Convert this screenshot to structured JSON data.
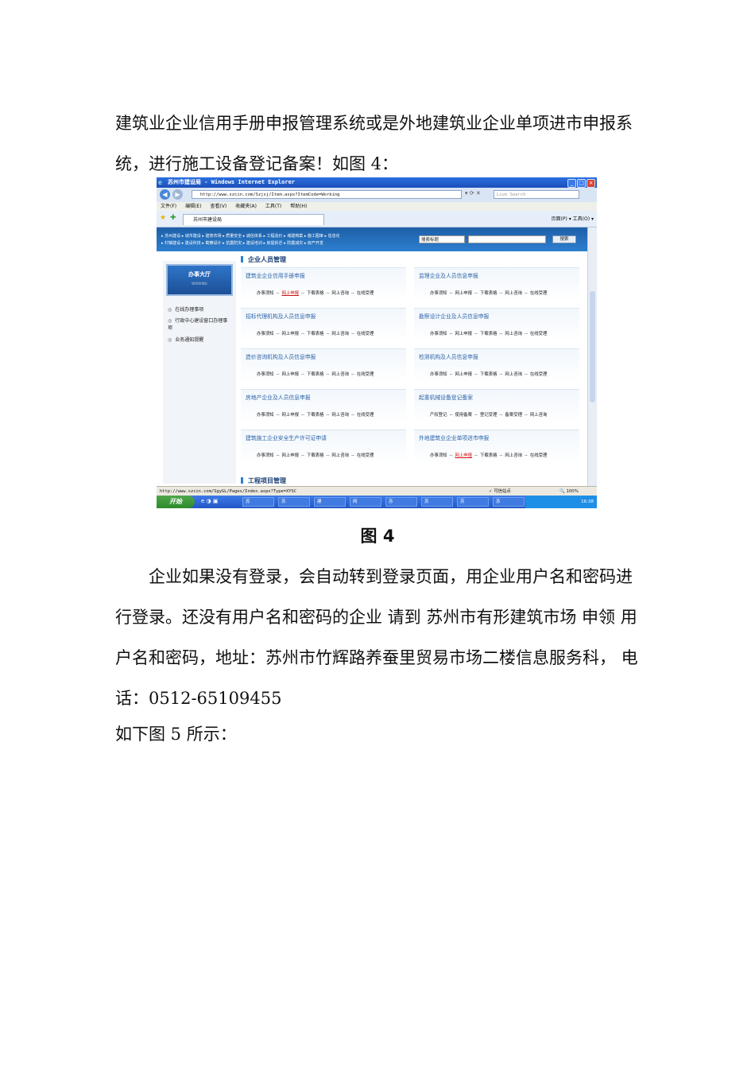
{
  "doc": {
    "para1": "建筑业企业信用手册申报管理系统或是外地建筑业企业单项进市申报系统，进行施工设备登记备案！如图 4：",
    "caption": "图 4",
    "para2": "企业如果没有登录，会自动转到登录页面，用企业用户名和密码进行登录。还没有用户名和密码的企业  请到  苏州市有形建筑市场  申领  用户名和密码，地址：苏州市竹辉路养蚕里贸易市场二楼信息服务科，   电话：0512-65109455",
    "para3": "如下图 5 所示："
  },
  "browser": {
    "window_title": "苏州市建设局 - Windows Internet Explorer",
    "address": "http://www.szcin.com/Szjsj/Item.aspx?ItemCode=Working",
    "live_search": "Live Search",
    "menu": [
      "文件(F)",
      "编辑(E)",
      "查看(V)",
      "收藏夹(A)",
      "工具(T)",
      "帮助(H)"
    ],
    "tab_title": "苏州市建设局",
    "cmd_tools": "页面(P) ▾  工具(O) ▾",
    "status_url": "http://www.szcin.com/SgyGL/Pages/Index.aspx?Type=XYSC",
    "status_zone": "可信站点",
    "zoom": "100%"
  },
  "site": {
    "header_links_1": "▸ 苏州建设 ▸ 城市建设 ▸ 建筑市场 ▸ 质量安全 ▸ 诚信体系 ▸ 工程造价 ▸ 城建档案 ▸ 施工图审 ▸ 信息化",
    "header_links_2": "▸ 村镇建设 ▸ 建设科技 ▸ 勘察设计 ▸ 抗震防灾 ▸ 建设培训 ▸ 房屋拆迁 ▸ 防震减灾 ▸ 房产开发",
    "search_select": "搜索标题",
    "search_button": "搜索",
    "hall_title": "办事大厅",
    "hall_sub": "WORKING",
    "sidebar": [
      "在线办理事项",
      "行政中心建设窗口办理事项",
      "业务通知提醒"
    ],
    "section1": "企业人员管理",
    "section2": "工程项目管理",
    "cards": [
      {
        "title": "建筑业企业信用手册申报",
        "links": [
          "办事须知",
          "网上申报",
          "下载表格",
          "网上咨询",
          "在线受理"
        ],
        "red": 1
      },
      {
        "title": "监理企业及人员信息申报",
        "links": [
          "办事须知",
          "网上申报",
          "下载表格",
          "网上咨询",
          "在线受理"
        ],
        "red": -1
      },
      {
        "title": "招标代理机构及人员信息申报",
        "links": [
          "办事须知",
          "网上申报",
          "下载表格",
          "网上咨询",
          "在线受理"
        ],
        "red": -1
      },
      {
        "title": "勘察设计企业及人员信息申报",
        "links": [
          "办事须知",
          "网上申报",
          "下载表格",
          "网上咨询",
          "在线受理"
        ],
        "red": -1
      },
      {
        "title": "造价咨询机构及人员信息申报",
        "links": [
          "办事须知",
          "网上申报",
          "下载表格",
          "网上咨询",
          "在线受理"
        ],
        "red": -1
      },
      {
        "title": "检测机构及人员信息申报",
        "links": [
          "办事须知",
          "网上申报",
          "下载表格",
          "网上咨询",
          "在线受理"
        ],
        "red": -1
      },
      {
        "title": "房地产企业及人员信息申报",
        "links": [
          "办事须知",
          "网上申报",
          "下载表格",
          "网上咨询",
          "在线受理"
        ],
        "red": -1
      },
      {
        "title": "起重机械设备登记备案",
        "links": [
          "产权登记",
          "使用备案",
          "登记受理",
          "备案受理",
          "网上咨询"
        ],
        "red": -1
      },
      {
        "title": "建筑施工企业安全生产许可证申请",
        "links": [
          "办事须知",
          "网上申报",
          "下载表格",
          "网上咨询",
          "在线受理"
        ],
        "red": -1
      },
      {
        "title": "外地建筑业企业单项进市申报",
        "links": [
          "办事须知",
          "网上申报",
          "下载表格",
          "网上咨询",
          "在线受理"
        ],
        "red": 1
      }
    ]
  },
  "taskbar": {
    "start": "开始",
    "buttons": [
      "苏",
      "苏",
      "建",
      "网",
      "苏",
      "苏",
      "苏",
      "苏"
    ],
    "clock": "16:38"
  }
}
